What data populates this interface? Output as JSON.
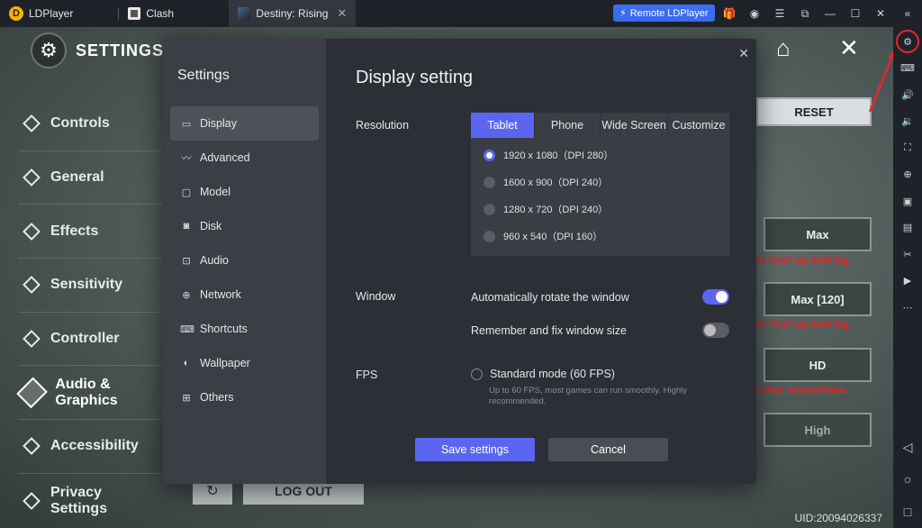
{
  "titlebar": {
    "app_name": "LDPlayer",
    "tabs": [
      {
        "label": "Clash"
      },
      {
        "label": "Destiny: Rising",
        "close": "✕"
      }
    ],
    "remote_label": "Remote LDPlayer"
  },
  "game": {
    "settings_title": "SETTINGS",
    "menu": [
      "Controls",
      "General",
      "Effects",
      "Sensitivity",
      "Controller",
      "Audio & Graphics",
      "Accessibility",
      "Privacy Settings"
    ],
    "reset_label": "RESET",
    "options": [
      "Max",
      "Max [120]",
      "HD",
      "High"
    ],
    "warnings": [
      "to heat up and lag.",
      "to heat up and lag.",
      "other instabilities."
    ],
    "logout_label": "LOG OUT",
    "uid": "UID:20094026337"
  },
  "dialog": {
    "sidebar_title": "Settings",
    "nav": [
      {
        "label": "Display",
        "icon": "monitor-icon"
      },
      {
        "label": "Advanced",
        "icon": "chart-icon"
      },
      {
        "label": "Model",
        "icon": "model-icon"
      },
      {
        "label": "Disk",
        "icon": "disk-icon"
      },
      {
        "label": "Audio",
        "icon": "gamepad-icon"
      },
      {
        "label": "Network",
        "icon": "globe-icon"
      },
      {
        "label": "Shortcuts",
        "icon": "keyboard-icon"
      },
      {
        "label": "Wallpaper",
        "icon": "palette-icon"
      },
      {
        "label": "Others",
        "icon": "grid-icon"
      }
    ],
    "title": "Display setting",
    "resolution": {
      "label": "Resolution",
      "tabs": [
        "Tablet",
        "Phone",
        "Wide Screen",
        "Customize"
      ],
      "selected_tab": "Tablet",
      "options": [
        "1920 x 1080（DPI 280）",
        "1600 x 900（DPI 240）",
        "1280 x 720（DPI 240）",
        "960 x 540（DPI 160）"
      ],
      "selected_index": 0
    },
    "window": {
      "label": "Window",
      "auto_rotate_label": "Automatically rotate the window",
      "auto_rotate_on": true,
      "remember_size_label": "Remember and fix window size",
      "remember_size_on": false
    },
    "fps": {
      "label": "FPS",
      "option_label": "Standard mode (60 FPS)",
      "option_desc": "Up to 60 FPS, most games can run smoothly. Highly recommended."
    },
    "save_label": "Save settings",
    "cancel_label": "Cancel"
  },
  "colors": {
    "accent": "#5b66f0",
    "highlight_red": "#e8262b"
  }
}
